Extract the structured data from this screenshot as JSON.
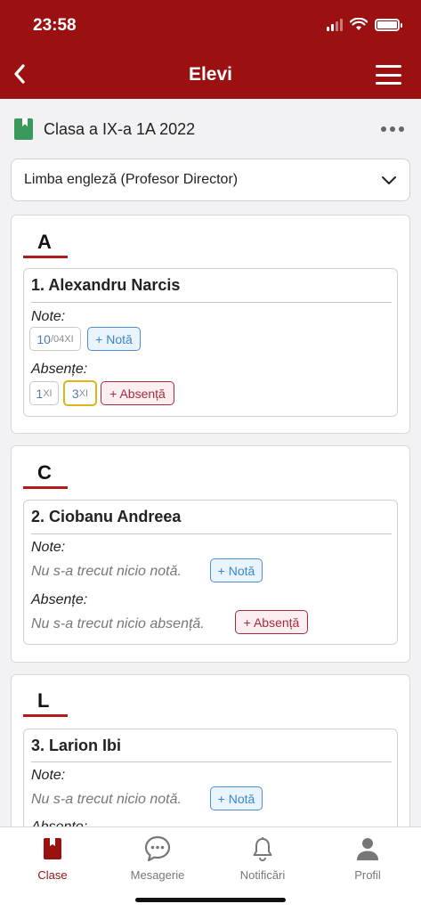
{
  "status_bar": {
    "time": "23:58"
  },
  "header": {
    "title": "Elevi"
  },
  "class_row": {
    "name": "Clasa a IX-a 1A 2022"
  },
  "subject_select": {
    "value": "Limba engleză (Profesor Director)"
  },
  "labels": {
    "grades": "Note:",
    "absences": "Absențe:",
    "add_grade": "+ Notă",
    "add_absence": "+ Absență",
    "no_grades": "Nu s-a trecut nicio notă.",
    "no_absences": "Nu s-a trecut nicio absență."
  },
  "groups": [
    {
      "letter": "A",
      "student": {
        "name": "1. Alexandru Narcis",
        "grades": [
          {
            "value": "10",
            "date": "/04XI"
          }
        ],
        "absences": [
          {
            "value": "1",
            "date": "XI"
          },
          {
            "value": "3",
            "date": "XI"
          }
        ]
      }
    },
    {
      "letter": "C",
      "student": {
        "name": "2. Ciobanu Andreea"
      }
    },
    {
      "letter": "L",
      "student": {
        "name": "3. Larion Ibi"
      }
    }
  ],
  "tabs": [
    {
      "label": "Clase",
      "icon": "book-icon"
    },
    {
      "label": "Mesagerie",
      "icon": "chat-bubble-icon"
    },
    {
      "label": "Notificări",
      "icon": "bell-icon"
    },
    {
      "label": "Profil",
      "icon": "person-icon"
    }
  ],
  "colors": {
    "brand": "#9b1010",
    "accent_blue": "#3b86c9",
    "absence_red": "#a52c3c",
    "highlight_yellow": "#e1b21a",
    "book_green": "#3a9a5b"
  }
}
